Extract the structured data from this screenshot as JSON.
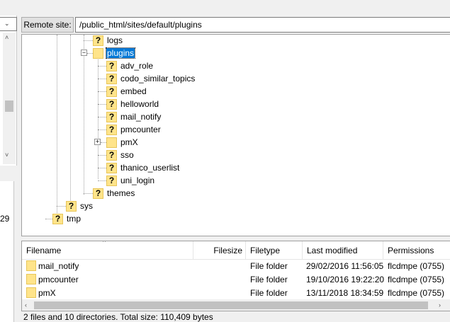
{
  "left_pane": {
    "dropdown_arrow": "⌄",
    "scroll_up_arrow": "˄",
    "scroll_down_arrow": "˅",
    "partial_number": "29"
  },
  "remote": {
    "label": "Remote site:",
    "path": "/public_html/sites/default/plugins"
  },
  "tree": {
    "items": [
      {
        "label": "logs",
        "icon": "unknown-folder-icon"
      },
      {
        "label": "plugins",
        "icon": "open-folder-icon",
        "selected": true,
        "expander": "−"
      },
      {
        "label": "adv_role",
        "icon": "unknown-folder-icon"
      },
      {
        "label": "codo_similar_topics",
        "icon": "unknown-folder-icon"
      },
      {
        "label": "embed",
        "icon": "unknown-folder-icon"
      },
      {
        "label": "helloworld",
        "icon": "unknown-folder-icon"
      },
      {
        "label": "mail_notify",
        "icon": "unknown-folder-icon"
      },
      {
        "label": "pmcounter",
        "icon": "unknown-folder-icon"
      },
      {
        "label": "pmX",
        "icon": "folder-icon",
        "expander": "+"
      },
      {
        "label": "sso",
        "icon": "unknown-folder-icon"
      },
      {
        "label": "thanico_userlist",
        "icon": "unknown-folder-icon"
      },
      {
        "label": "uni_login",
        "icon": "unknown-folder-icon"
      },
      {
        "label": "themes",
        "icon": "unknown-folder-icon"
      },
      {
        "label": "sys",
        "icon": "unknown-folder-icon"
      },
      {
        "label": "tmp",
        "icon": "unknown-folder-icon"
      }
    ],
    "unknown_glyph": "?"
  },
  "file_list": {
    "sort_indicator": "^",
    "columns": [
      "Filename",
      "Filesize",
      "Filetype",
      "Last modified",
      "Permissions"
    ],
    "rows": [
      {
        "name": "mail_notify",
        "size": "",
        "type": "File folder",
        "modified": "29/02/2016 11:56:05",
        "permissions": "flcdmpe (0755)"
      },
      {
        "name": "pmcounter",
        "size": "",
        "type": "File folder",
        "modified": "19/10/2016 19:22:20",
        "permissions": "flcdmpe (0755)"
      },
      {
        "name": "pmX",
        "size": "",
        "type": "File folder",
        "modified": "13/11/2018 18:34:59",
        "permissions": "flcdmpe (0755)"
      }
    ],
    "scroll_left": "‹",
    "scroll_right": "›"
  },
  "status": {
    "text": "2 files and 10 directories. Total size: 110,409 bytes"
  },
  "colors": {
    "selection": "#0078d7",
    "folder": "#ffe48a"
  }
}
